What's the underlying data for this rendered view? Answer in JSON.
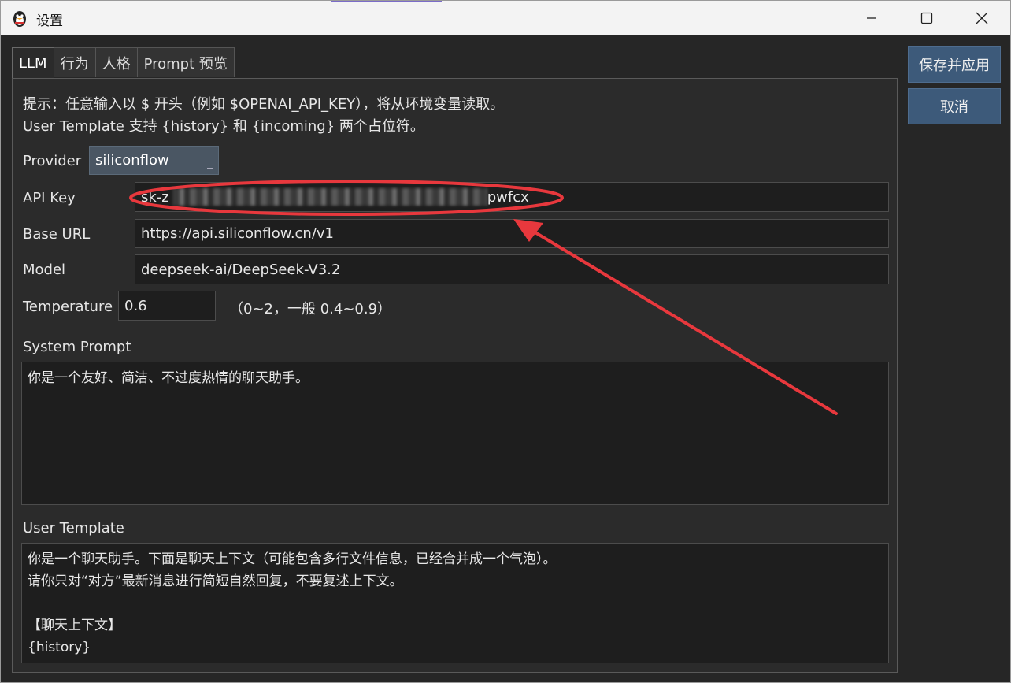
{
  "window": {
    "title": "设置"
  },
  "tabs": [
    {
      "label": "LLM"
    },
    {
      "label": "行为"
    },
    {
      "label": "人格"
    },
    {
      "label": "Prompt 预览"
    }
  ],
  "hints": {
    "line1": "提示：任意输入以 $ 开头（例如 $OPENAI_API_KEY），将从环境变量读取。",
    "line2": "User Template 支持 {history} 和 {incoming} 两个占位符。"
  },
  "form": {
    "provider_label": "Provider",
    "provider_value": "siliconflow",
    "api_key_label": "API Key",
    "api_key_prefix": "sk-z",
    "api_key_suffix": "pwfcx",
    "base_url_label": "Base URL",
    "base_url_value": "https://api.siliconflow.cn/v1",
    "model_label": "Model",
    "model_value": "deepseek-ai/DeepSeek-V3.2",
    "temperature_label": "Temperature",
    "temperature_value": "0.6",
    "temperature_note": "（0~2，一般 0.4~0.9）",
    "system_prompt_label": "System Prompt",
    "system_prompt_value": "你是一个友好、简洁、不过度热情的聊天助手。",
    "user_template_label": "User Template",
    "user_template_value": "你是一个聊天助手。下面是聊天上下文（可能包含多行文件信息，已经合并成一个气泡）。\n请你只对“对方”最新消息进行简短自然回复，不要复述上下文。\n\n【聊天上下文】\n{history}"
  },
  "buttons": {
    "save_apply": "保存并应用",
    "cancel": "取消"
  },
  "colors": {
    "annotation": "#e8383d",
    "primary_button": "#3d5a7a",
    "background": "#262626"
  },
  "icons": [
    "app-icon",
    "minimize-icon",
    "maximize-icon",
    "close-icon"
  ]
}
